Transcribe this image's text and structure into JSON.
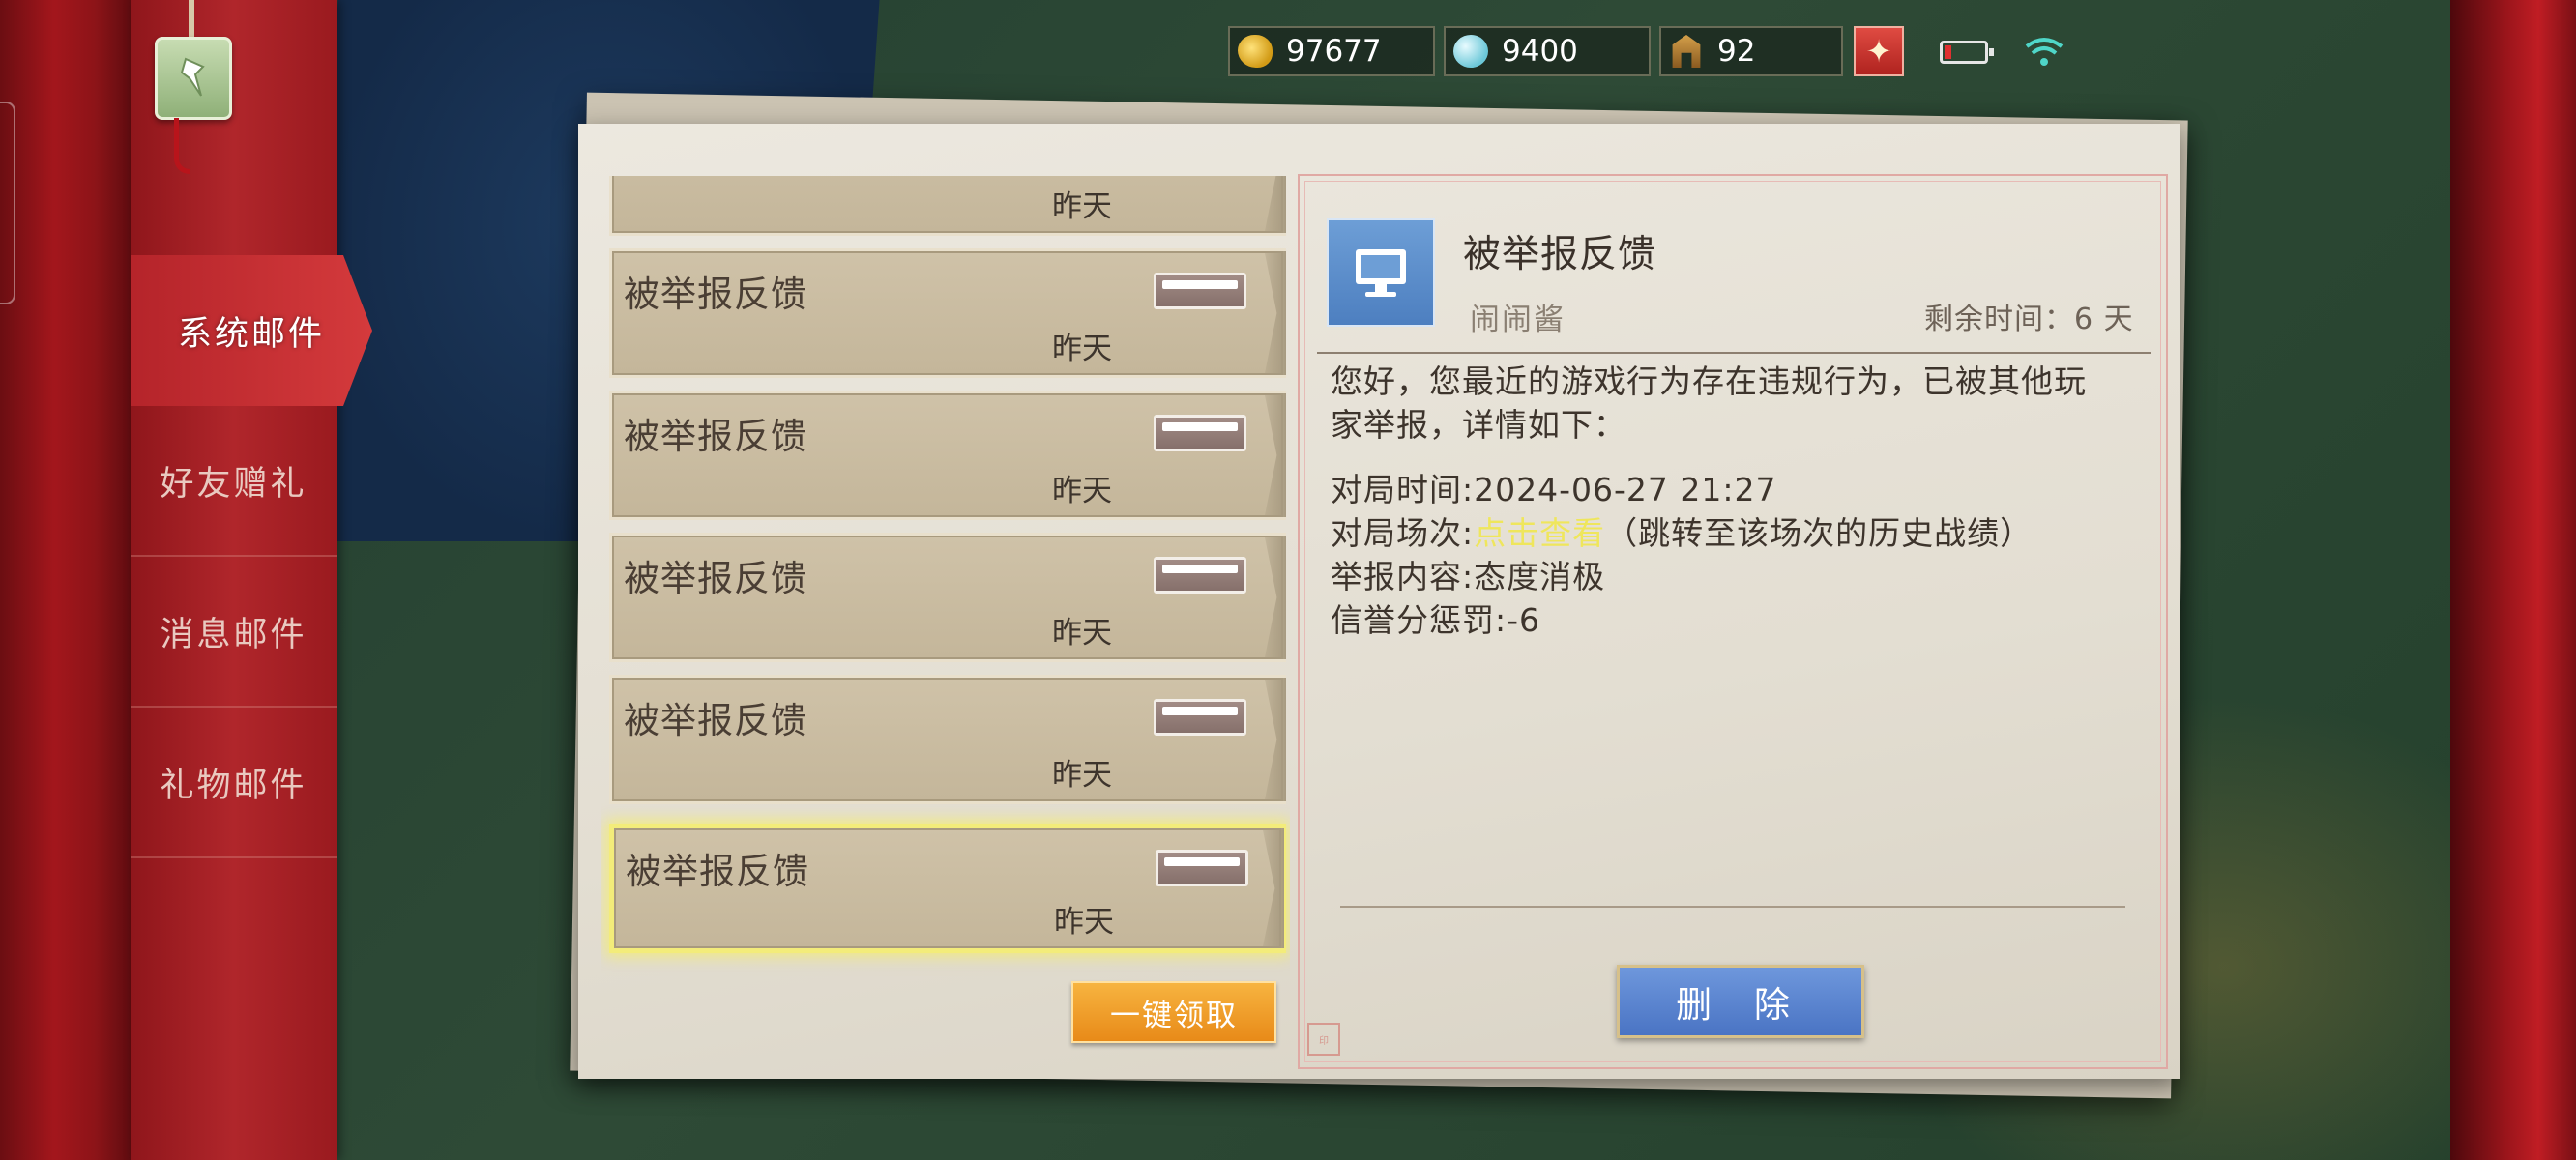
{
  "top_bar": {
    "gold": "97677",
    "gems": "9400",
    "tickets": "92"
  },
  "sidebar": {
    "items": [
      {
        "label": "系统邮件",
        "active": true
      },
      {
        "label": "好友赠礼",
        "active": false
      },
      {
        "label": "消息邮件",
        "active": false
      },
      {
        "label": "礼物邮件",
        "active": false
      }
    ]
  },
  "mail_list": {
    "items": [
      {
        "title": "",
        "date": "昨天"
      },
      {
        "title": "被举报反馈",
        "date": "昨天"
      },
      {
        "title": "被举报反馈",
        "date": "昨天"
      },
      {
        "title": "被举报反馈",
        "date": "昨天"
      },
      {
        "title": "被举报反馈",
        "date": "昨天"
      },
      {
        "title": "被举报反馈",
        "date": "昨天",
        "selected": true
      }
    ],
    "claim_all_label": "一键领取"
  },
  "detail": {
    "title": "被举报反馈",
    "sender": "闹闹酱",
    "remaining": "剩余时间：6 天",
    "body_line1": "您好，您最近的游戏行为存在违规行为，已被其他玩",
    "body_line2": "家举报，详情如下：",
    "match_time": "对局时间:2024-06-27 21:27",
    "match_session_prefix": "对局场次:",
    "match_session_link": "点击查看",
    "match_session_suffix": "（跳转至该场次的历史战绩）",
    "report_content": "举报内容:态度消极",
    "credit_penalty": "信誉分惩罚:-6",
    "delete_label": "删 除"
  },
  "colors": {
    "link": "#efe65c",
    "delete_button": "#5a84cf",
    "claim_button": "#f0a02c",
    "sidebar_active": "#c62f33"
  }
}
